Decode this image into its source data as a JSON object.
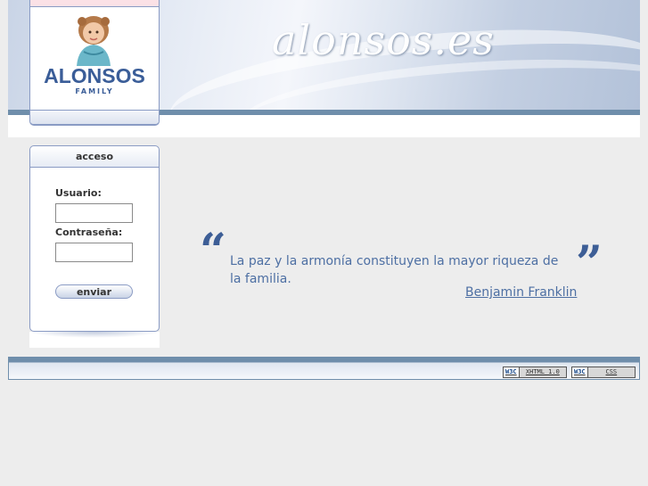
{
  "header": {
    "site_title": "alonsos.es"
  },
  "logo": {
    "name": "ALONSOS",
    "sub": "FAMILY"
  },
  "login": {
    "title": "acceso",
    "user_label": "Usuario:",
    "user_value": "",
    "password_label": "Contraseña:",
    "password_value": "",
    "submit_label": "enviar"
  },
  "quote": {
    "open_mark": "“",
    "text": "La paz y la armonía constituyen la mayor riqueza de la familia.",
    "close_mark": "”",
    "author": "Benjamin Franklin"
  },
  "footer": {
    "badges": [
      {
        "w3": "W3C",
        "label": "XHTML 1.0"
      },
      {
        "w3": "W3C",
        "label": "CSS"
      }
    ]
  },
  "colors": {
    "accent": "#3a5d98",
    "bar": "#6f8eab",
    "quote_text": "#4d6fa3"
  }
}
